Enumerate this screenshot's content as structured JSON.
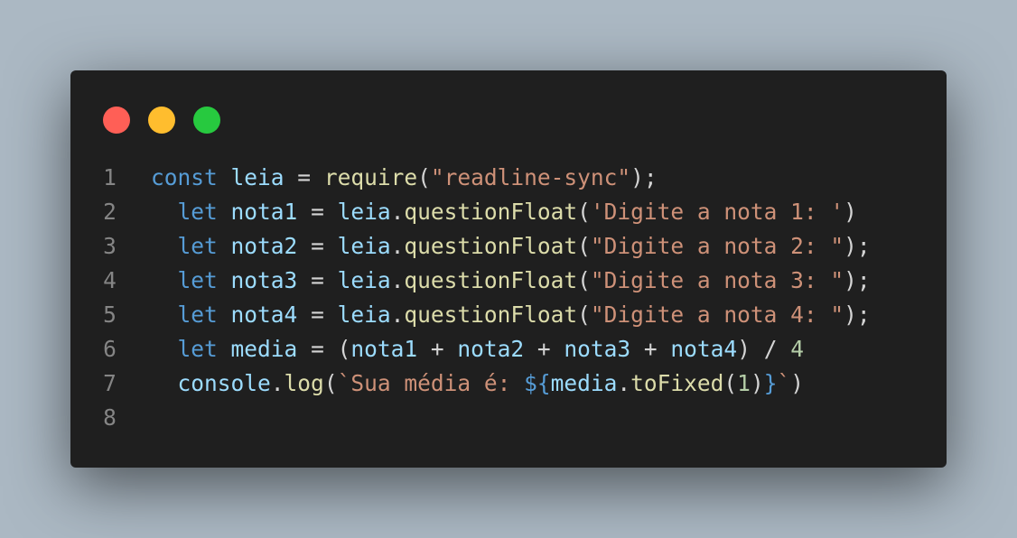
{
  "window": {
    "controls": [
      "close",
      "minimize",
      "maximize"
    ],
    "colors": {
      "background": "#1f1f1f",
      "page_background": "#abb8c3",
      "close": "#ff5f56",
      "minimize": "#ffbd2e",
      "maximize": "#27c93f"
    }
  },
  "code": {
    "line_numbers": [
      "1",
      "2",
      "3",
      "4",
      "5",
      "6",
      "7",
      "8"
    ],
    "lines": [
      [
        {
          "t": "const",
          "c": "kw"
        },
        {
          "t": " ",
          "c": "op"
        },
        {
          "t": "leia",
          "c": "var"
        },
        {
          "t": " = ",
          "c": "op"
        },
        {
          "t": "require",
          "c": "fn"
        },
        {
          "t": "(",
          "c": "punc"
        },
        {
          "t": "\"readline-sync\"",
          "c": "str"
        },
        {
          "t": ");",
          "c": "punc"
        }
      ],
      [
        {
          "t": "  ",
          "c": "op"
        },
        {
          "t": "let",
          "c": "kw"
        },
        {
          "t": " ",
          "c": "op"
        },
        {
          "t": "nota1",
          "c": "var"
        },
        {
          "t": " = ",
          "c": "op"
        },
        {
          "t": "leia",
          "c": "var"
        },
        {
          "t": ".",
          "c": "punc"
        },
        {
          "t": "questionFloat",
          "c": "fn"
        },
        {
          "t": "(",
          "c": "punc"
        },
        {
          "t": "'Digite a nota 1: '",
          "c": "str"
        },
        {
          "t": ")",
          "c": "punc"
        }
      ],
      [
        {
          "t": "  ",
          "c": "op"
        },
        {
          "t": "let",
          "c": "kw"
        },
        {
          "t": " ",
          "c": "op"
        },
        {
          "t": "nota2",
          "c": "var"
        },
        {
          "t": " = ",
          "c": "op"
        },
        {
          "t": "leia",
          "c": "var"
        },
        {
          "t": ".",
          "c": "punc"
        },
        {
          "t": "questionFloat",
          "c": "fn"
        },
        {
          "t": "(",
          "c": "punc"
        },
        {
          "t": "\"Digite a nota 2: \"",
          "c": "str"
        },
        {
          "t": ");",
          "c": "punc"
        }
      ],
      [
        {
          "t": "  ",
          "c": "op"
        },
        {
          "t": "let",
          "c": "kw"
        },
        {
          "t": " ",
          "c": "op"
        },
        {
          "t": "nota3",
          "c": "var"
        },
        {
          "t": " = ",
          "c": "op"
        },
        {
          "t": "leia",
          "c": "var"
        },
        {
          "t": ".",
          "c": "punc"
        },
        {
          "t": "questionFloat",
          "c": "fn"
        },
        {
          "t": "(",
          "c": "punc"
        },
        {
          "t": "\"Digite a nota 3: \"",
          "c": "str"
        },
        {
          "t": ");",
          "c": "punc"
        }
      ],
      [
        {
          "t": "  ",
          "c": "op"
        },
        {
          "t": "let",
          "c": "kw"
        },
        {
          "t": " ",
          "c": "op"
        },
        {
          "t": "nota4",
          "c": "var"
        },
        {
          "t": " = ",
          "c": "op"
        },
        {
          "t": "leia",
          "c": "var"
        },
        {
          "t": ".",
          "c": "punc"
        },
        {
          "t": "questionFloat",
          "c": "fn"
        },
        {
          "t": "(",
          "c": "punc"
        },
        {
          "t": "\"Digite a nota 4: \"",
          "c": "str"
        },
        {
          "t": ");",
          "c": "punc"
        }
      ],
      [
        {
          "t": "  ",
          "c": "op"
        },
        {
          "t": "let",
          "c": "kw"
        },
        {
          "t": " ",
          "c": "op"
        },
        {
          "t": "media",
          "c": "var"
        },
        {
          "t": " = (",
          "c": "op"
        },
        {
          "t": "nota1",
          "c": "var"
        },
        {
          "t": " + ",
          "c": "op"
        },
        {
          "t": "nota2",
          "c": "var"
        },
        {
          "t": " + ",
          "c": "op"
        },
        {
          "t": "nota3",
          "c": "var"
        },
        {
          "t": " + ",
          "c": "op"
        },
        {
          "t": "nota4",
          "c": "var"
        },
        {
          "t": ") / ",
          "c": "op"
        },
        {
          "t": "4",
          "c": "num"
        }
      ],
      [
        {
          "t": "  ",
          "c": "op"
        },
        {
          "t": "console",
          "c": "var"
        },
        {
          "t": ".",
          "c": "punc"
        },
        {
          "t": "log",
          "c": "fn"
        },
        {
          "t": "(",
          "c": "punc"
        },
        {
          "t": "`Sua média é: ",
          "c": "str"
        },
        {
          "t": "${",
          "c": "tpl"
        },
        {
          "t": "media",
          "c": "var"
        },
        {
          "t": ".",
          "c": "punc"
        },
        {
          "t": "toFixed",
          "c": "fn"
        },
        {
          "t": "(",
          "c": "punc"
        },
        {
          "t": "1",
          "c": "num"
        },
        {
          "t": ")",
          "c": "punc"
        },
        {
          "t": "}",
          "c": "tpl"
        },
        {
          "t": "`",
          "c": "str"
        },
        {
          "t": ")",
          "c": "punc"
        }
      ],
      []
    ]
  }
}
